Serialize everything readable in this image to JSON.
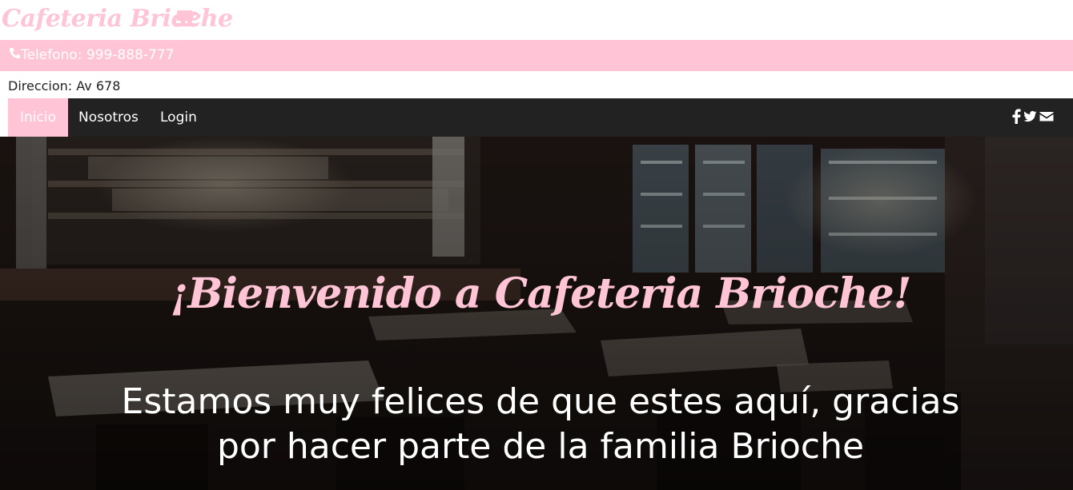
{
  "brand": {
    "name": "Cafeteria Brioche",
    "icon": "coffee-cup-icon",
    "color": "#ffc5d6"
  },
  "contact": {
    "phone_icon": "phone-icon",
    "phone_label": "Telefono: 999-888-777",
    "address_label": "Direccion: Av 678"
  },
  "nav": {
    "items": [
      {
        "label": "Inicio",
        "active": true
      },
      {
        "label": "Nosotros",
        "active": false
      },
      {
        "label": "Login",
        "active": false
      }
    ],
    "social": [
      "facebook-icon",
      "twitter-icon",
      "envelope-icon"
    ],
    "background": "#222222",
    "active_color": "#ffc5d6"
  },
  "hero": {
    "title": "¡Bienvenido a Cafeteria Brioche!",
    "subtitle_line1": "Estamos muy felices de que estes aquí, gracias",
    "subtitle_line2": "por hacer parte de la familia Brioche"
  }
}
